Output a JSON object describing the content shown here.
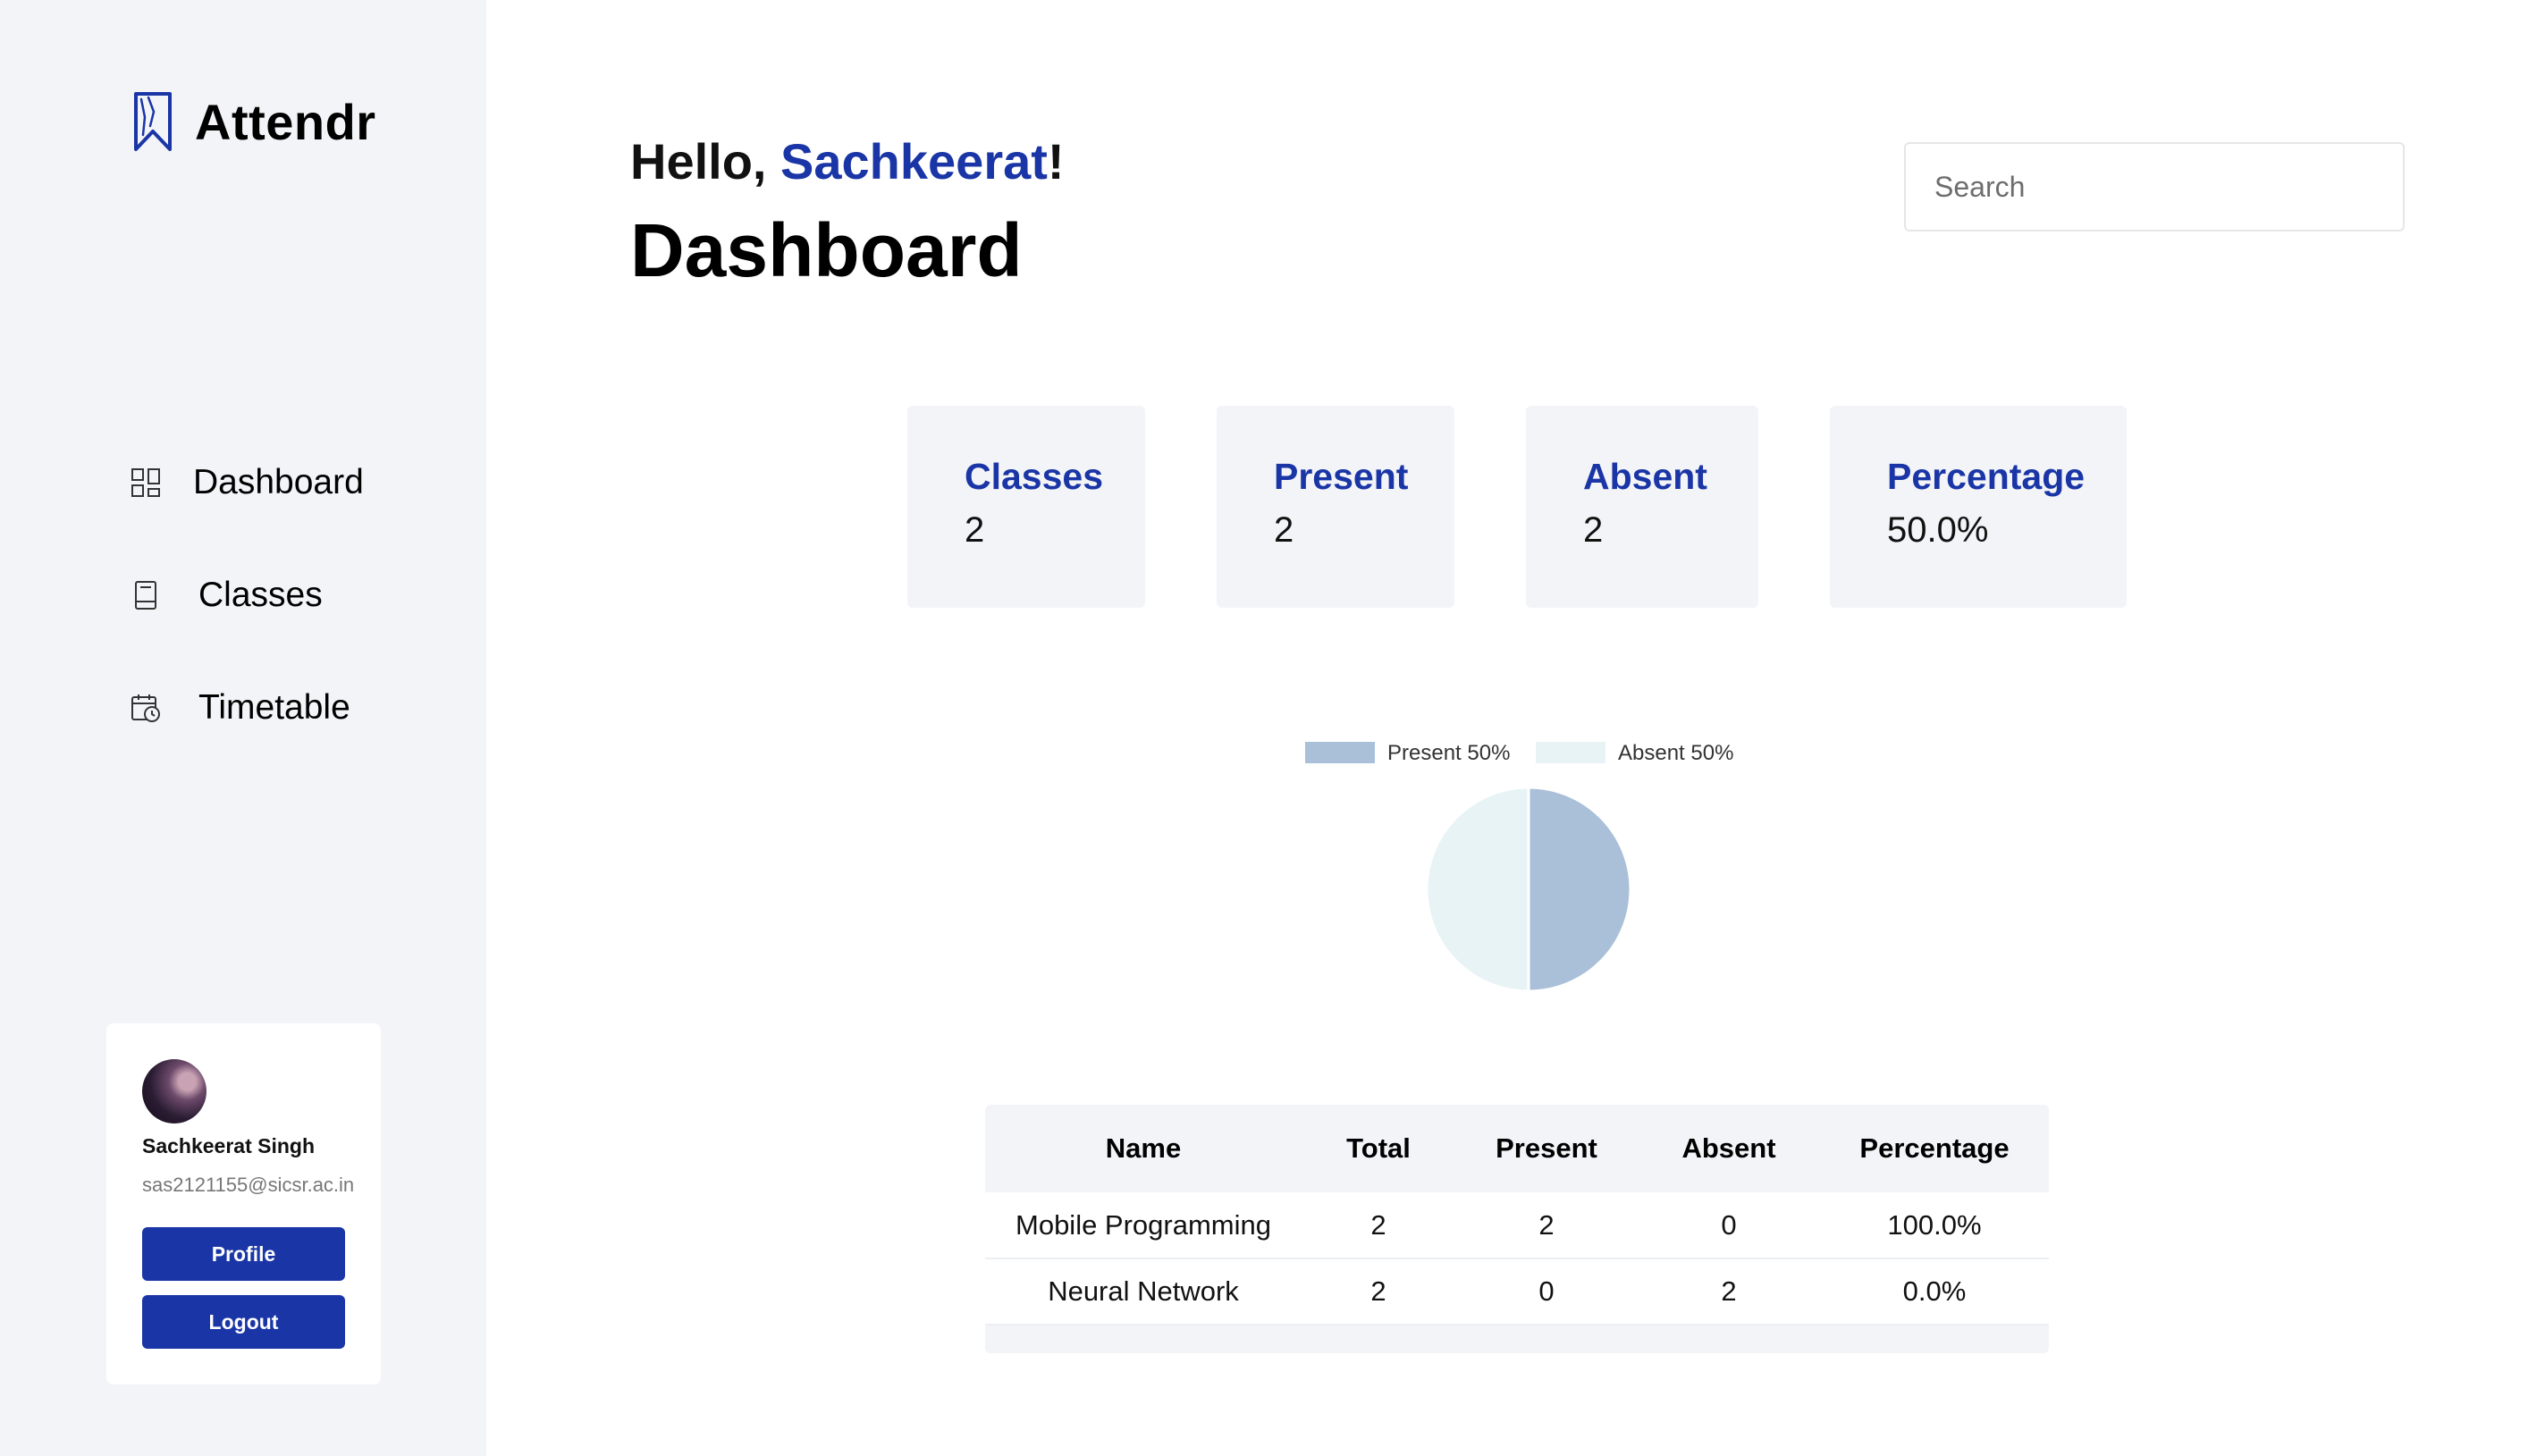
{
  "app": {
    "name": "Attendr"
  },
  "nav": {
    "items": [
      {
        "label": "Dashboard",
        "icon": "grid-icon"
      },
      {
        "label": "Classes",
        "icon": "book-icon"
      },
      {
        "label": "Timetable",
        "icon": "calendar-clock-icon"
      }
    ]
  },
  "user": {
    "name": "Sachkeerat Singh",
    "email": "sas2121155@sicsr.ac.in",
    "profile_label": "Profile",
    "logout_label": "Logout"
  },
  "header": {
    "greeting_prefix": "Hello, ",
    "greeting_name": "Sachkeerat",
    "greeting_suffix": "!",
    "title": "Dashboard"
  },
  "search": {
    "placeholder": "Search",
    "value": ""
  },
  "stats": [
    {
      "label": "Classes",
      "value": "2"
    },
    {
      "label": "Present",
      "value": "2"
    },
    {
      "label": "Absent",
      "value": "2"
    },
    {
      "label": "Percentage",
      "value": "50.0%"
    }
  ],
  "chart_data": {
    "type": "pie",
    "categories": [
      "Present",
      "Absent"
    ],
    "values": [
      50,
      50
    ],
    "legend": [
      "Present 50%",
      "Absent 50%"
    ],
    "colors": [
      "#aac0d9",
      "#e8f3f6"
    ],
    "legend_placement": "top"
  },
  "table": {
    "headers": [
      "Name",
      "Total",
      "Present",
      "Absent",
      "Percentage"
    ],
    "rows": [
      [
        "Mobile Programming",
        "2",
        "2",
        "0",
        "100.0%"
      ],
      [
        "Neural Network",
        "2",
        "0",
        "2",
        "0.0%"
      ]
    ]
  },
  "colors": {
    "accent": "#1a35a6",
    "sidebar_bg": "#f3f4f7",
    "card_bg": "#f3f4f7"
  }
}
